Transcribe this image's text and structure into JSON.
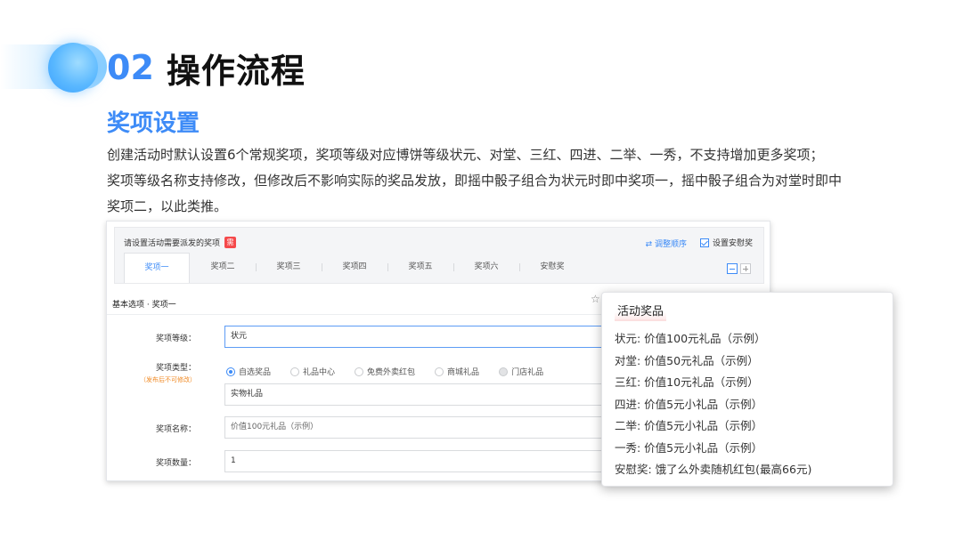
{
  "section": {
    "number": "02",
    "title": "操作流程"
  },
  "subtitle": "奖项设置",
  "description": [
    "创建活动时默认设置6个常规奖项，奖项等级对应博饼等级状元、对堂、三红、四进、二举、一秀，不支持增加更多奖项；",
    "奖项等级名称支持修改，但修改后不影响实际的奖品发放，即摇中骰子组合为状元时即中奖项一，摇中骰子组合为对堂时即中",
    "奖项二，以此类推。"
  ],
  "screenshot": {
    "panel_title": "请设置活动需要派发的奖项",
    "required_badge": "需",
    "reorder_label": "调整顺序",
    "consolation_checkbox_label": "设置安慰奖",
    "tabs": [
      "奖项一",
      "奖项二",
      "奖项三",
      "奖项四",
      "奖项五",
      "奖项六",
      "安慰奖"
    ],
    "active_tab": "奖项一",
    "basic_options": "基本选项 · 奖项一",
    "form": {
      "level_label": "奖项等级：",
      "level_value": "状元",
      "type_label": "奖项类型：",
      "type_hint": "（发布后不可修改）",
      "type_options": [
        "自选奖品",
        "礼品中心",
        "免费外卖红包",
        "商城礼品",
        "门店礼品"
      ],
      "type_selected": "自选奖品",
      "type_sub_value": "实物礼品",
      "name_label": "奖项名称：",
      "name_value": "价值100元礼品（示例）",
      "qty_label": "奖项数量：",
      "qty_value": "1"
    }
  },
  "popup": {
    "title": "活动奖品",
    "items": [
      "状元: 价值100元礼品（示例）",
      "对堂: 价值50元礼品（示例）",
      "三红: 价值10元礼品（示例）",
      "四进: 价值5元小礼品（示例）",
      "二举: 价值5元小礼品（示例）",
      "一秀: 价值5元小礼品（示例）",
      "安慰奖: 饿了么外卖随机红包(最高66元)"
    ]
  },
  "colors": {
    "accent": "#3d8bf7",
    "badge": "#f5494b",
    "hint": "#f08a24"
  }
}
